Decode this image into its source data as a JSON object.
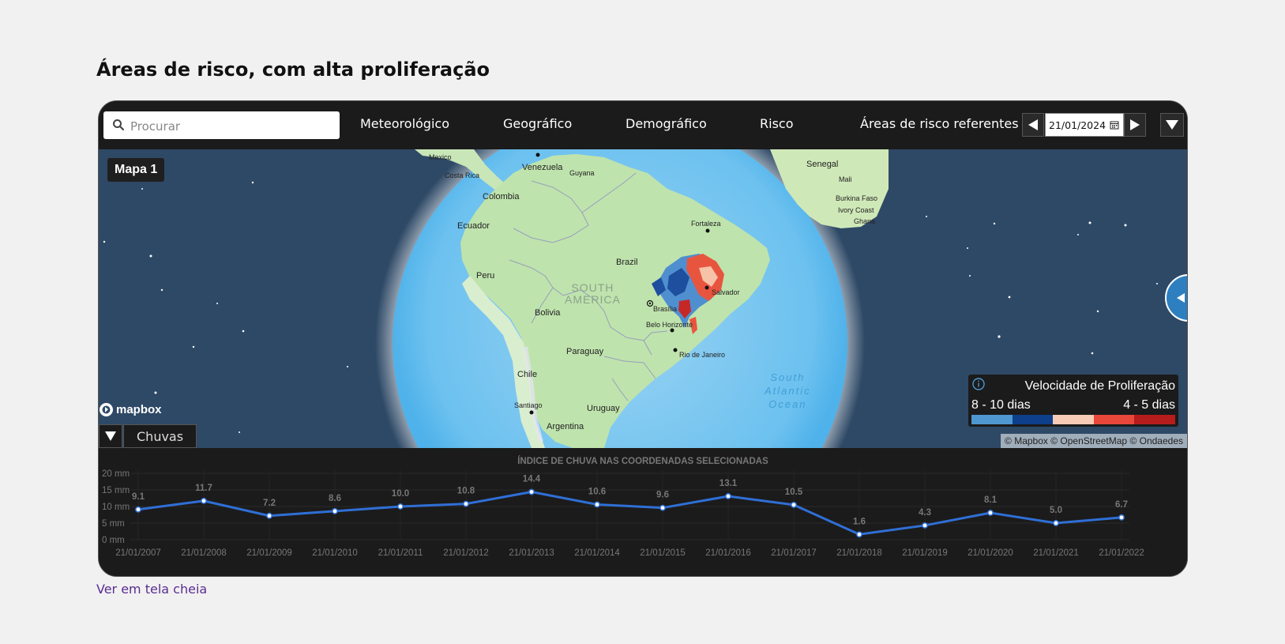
{
  "page": {
    "title": "Áreas de risco, com alta proliferação",
    "fullscreen_link": "Ver em tela cheia"
  },
  "toolbar": {
    "search_placeholder": "Procurar",
    "nav": [
      "Meteorológico",
      "Geográfico",
      "Demográfico",
      "Risco"
    ],
    "date_label": "Áreas de risco referentes a",
    "date_value": "21/01/2024"
  },
  "map": {
    "tag": "Mapa 1",
    "logo": "mapbox",
    "attribution": "© Mapbox © OpenStreetMap © Ondaedes",
    "labels": {
      "mexico": "Mexico",
      "costa_rica": "Costa Rica",
      "venezuela": "Venezuela",
      "guyana": "Guyana",
      "colombia": "Colombia",
      "ecuador": "Ecuador",
      "peru": "Peru",
      "brazil": "Brazil",
      "bolivia": "Bolivia",
      "paraguay": "Paraguay",
      "chile": "Chile",
      "argentina": "Argentina",
      "uruguay": "Uruguay",
      "santiago": "Santiago",
      "brasilia": "Brasília",
      "belo_horizonte": "Belo Horizonte",
      "rio": "Rio de Janeiro",
      "salvador": "Salvador",
      "fortaleza": "Fortaleza",
      "senegal": "Senegal",
      "mali": "Mali",
      "burkina": "Burkina Faso",
      "ivory": "Ivory Coast",
      "ghana": "Ghana",
      "south_america_1": "SOUTH",
      "south_america_2": "AMERICA",
      "ocean_1": "South",
      "ocean_2": "Atlantic",
      "ocean_3": "Ocean"
    },
    "legend": {
      "title": "Velocidade de Proliferação",
      "low_label": "8 - 10 dias",
      "high_label": "4 - 5 dias",
      "colors": [
        "#4f97d0",
        "#0d3f8a",
        "#f8cbb6",
        "#e8473a",
        "#b71c1c"
      ]
    },
    "layer": {
      "name": "Chuvas"
    }
  },
  "chart_data": {
    "type": "line",
    "title": "ÍNDICE DE CHUVA NAS COORDENADAS SELECIONADAS",
    "categories": [
      "21/01/2007",
      "21/01/2008",
      "21/01/2009",
      "21/01/2010",
      "21/01/2011",
      "21/01/2012",
      "21/01/2013",
      "21/01/2014",
      "21/01/2015",
      "21/01/2016",
      "21/01/2017",
      "21/01/2018",
      "21/01/2019",
      "21/01/2020",
      "21/01/2021",
      "21/01/2022"
    ],
    "values": [
      9.1,
      11.7,
      7.2,
      8.6,
      10.0,
      10.8,
      14.4,
      10.6,
      9.6,
      13.1,
      10.5,
      1.6,
      4.3,
      8.1,
      5.0,
      6.7
    ],
    "value_labels": [
      "9.1",
      "11.7",
      "7.2",
      "8.6",
      "10.0",
      "10.8",
      "14.4",
      "10.6",
      "9.6",
      "13.1",
      "10.5",
      "1.6",
      "4.3",
      "8.1",
      "5.0",
      "6.7"
    ],
    "yticks": [
      0,
      5,
      10,
      15,
      20
    ],
    "ytick_labels": [
      "0 mm",
      "5 mm",
      "10 mm",
      "15 mm",
      "20 mm"
    ],
    "ylim": [
      0,
      20
    ],
    "color": "#2f6fd6"
  }
}
